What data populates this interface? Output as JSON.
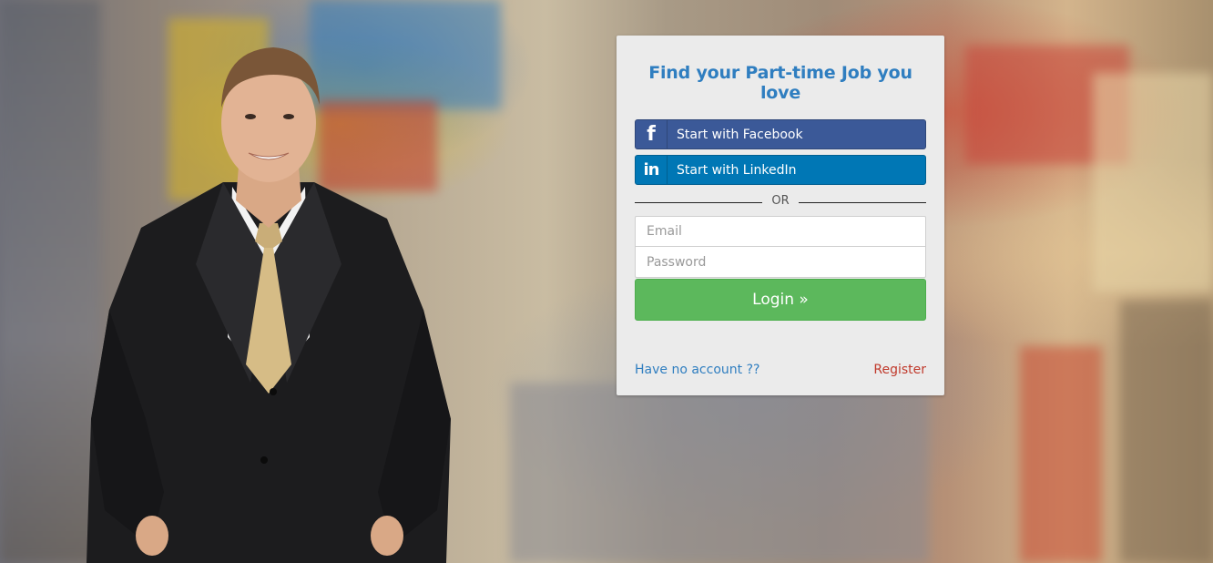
{
  "login_card": {
    "title": "Find your Part-time Job you love",
    "facebook": {
      "icon": "f",
      "label": "Start with Facebook",
      "color": "#3b5998"
    },
    "linkedin": {
      "icon": "in",
      "label": "Start with LinkedIn",
      "color": "#0077b5"
    },
    "divider_text": "OR",
    "email_placeholder": "Email",
    "password_placeholder": "Password",
    "login_label": "Login »",
    "login_color": "#5cb85c",
    "no_account_text": "Have no account ??",
    "register_label": "Register"
  }
}
